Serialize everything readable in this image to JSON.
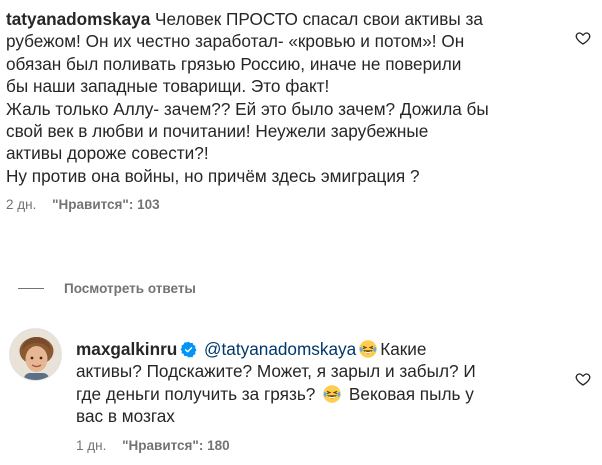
{
  "comment_1": {
    "username": "tatyanadomskaya",
    "lines": [
      "Человек ПРОСТО спасал свои активы за",
      "рубежом! Он их честно заработал- «кровью и потом»! Он",
      "обязан был поливать грязью Россию, иначе не поверили",
      "бы наши западные товарищи. Это факт!",
      "Жаль только Аллу- зачем?? Ей это было зачем? Дожила бы",
      "свой век в любви и почитании! Неужели зарубежные",
      "активы дороже совести?!",
      "Ну против она войны, но причём здесь эмиграция ?"
    ],
    "time": "2 дн.",
    "likes": "\"Нравится\": 103"
  },
  "view_replies_label": "Посмотреть ответы",
  "comment_2": {
    "username": "maxgalkinru",
    "mention": "@tatyanadomskaya",
    "line1_after_emoji": "Какие",
    "line2": "активы? Подскажите? Может, я зарыл и забыл? И",
    "line3_before_emoji": "где деньги получить за грязь?",
    "line3_after_emoji": "Вековая пыль у",
    "line4": "вас в мозгах",
    "time": "1 дн.",
    "likes": "\"Нравится\": 180"
  },
  "icons": {
    "heart": "heart-outline-icon",
    "verified": "verified-badge-icon",
    "emoji": "laughing-with-tears-emoji"
  },
  "colors": {
    "verified_blue": "#0095f6",
    "meta_gray": "#737373",
    "text": "#262626"
  }
}
